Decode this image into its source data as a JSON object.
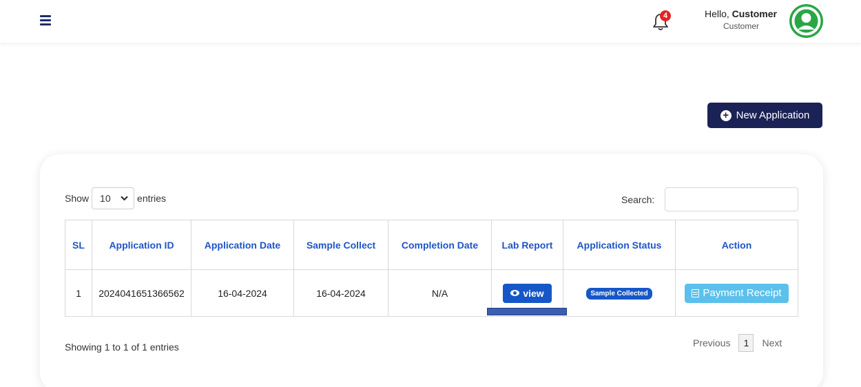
{
  "header": {
    "notification_count": "4",
    "greeting_prefix": "Hello,",
    "user_name": "Customer",
    "user_role": "Customer"
  },
  "actions": {
    "new_application_label": "New Application"
  },
  "table_controls": {
    "show_label": "Show",
    "entries_value": "10",
    "entries_label": "entries",
    "search_label": "Search:",
    "search_value": ""
  },
  "table": {
    "columns": [
      "SL",
      "Application ID",
      "Application Date",
      "Sample Collect",
      "Completion Date",
      "Lab Report",
      "Application Status",
      "Action"
    ],
    "rows": [
      {
        "sl": "1",
        "application_id": "2024041651366562",
        "application_date": "16-04-2024",
        "sample_collect": "16-04-2024",
        "completion_date": "N/A",
        "lab_report_button": "view",
        "status": "Sample Collected",
        "action_button": "Payment Receipt"
      }
    ]
  },
  "footer": {
    "showing_text": "Showing 1 to 1 of 1 entries",
    "previous_label": "Previous",
    "current_page": "1",
    "next_label": "Next"
  },
  "colors": {
    "primary_dark": "#1b2256",
    "header_text_blue": "#1e54c7",
    "button_blue": "#1657c8",
    "receipt_button": "#5bc0eb",
    "avatar_green": "#29a745",
    "badge_red": "#e02424"
  },
  "icons": [
    "hamburger-menu-icon",
    "bell-icon",
    "user-avatar-icon",
    "plus-circle-icon",
    "chevron-down-icon",
    "eye-icon",
    "document-icon"
  ]
}
